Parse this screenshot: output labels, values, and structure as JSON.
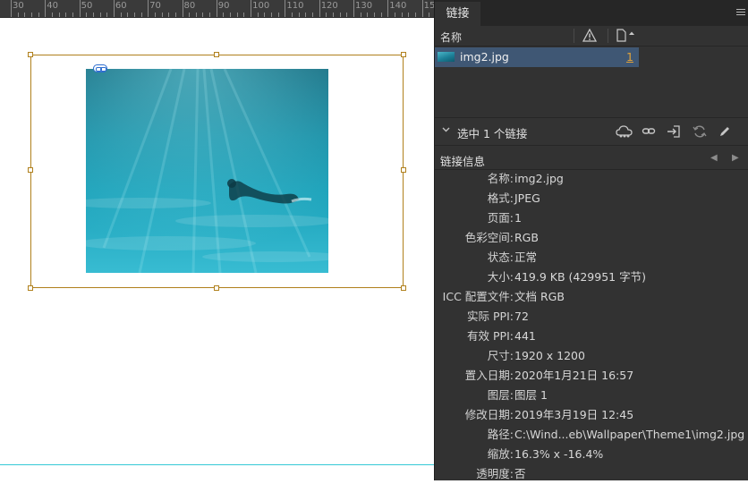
{
  "ruler": {
    "labels": [
      "30",
      "40",
      "50",
      "60",
      "70",
      "80",
      "90",
      "100",
      "110",
      "120",
      "130",
      "140",
      "150"
    ]
  },
  "panel": {
    "tab_label": "链接",
    "column_name": "名称",
    "links": [
      {
        "name": "img2.jpg",
        "page": "1"
      }
    ],
    "selection_label": "选中 1 个链接",
    "info_title": "链接信息",
    "info": [
      {
        "key": "名称:",
        "value": "img2.jpg"
      },
      {
        "key": "格式:",
        "value": "JPEG"
      },
      {
        "key": "页面:",
        "value": "1"
      },
      {
        "key": "色彩空间:",
        "value": "RGB"
      },
      {
        "key": "状态:",
        "value": "正常"
      },
      {
        "key": "大小:",
        "value": "419.9 KB   (429951 字节)"
      },
      {
        "key": "ICC 配置文件:",
        "value": "文档 RGB"
      },
      {
        "key": "实际 PPI:",
        "value": "72"
      },
      {
        "key": "有效 PPI:",
        "value": "441"
      },
      {
        "key": "尺寸:",
        "value": "1920 x 1200"
      },
      {
        "key": "置入日期:",
        "value": "2020年1月21日 16:57"
      },
      {
        "key": "图层:",
        "value": "图层 1"
      },
      {
        "key": "修改日期:",
        "value": "2019年3月19日 12:45"
      },
      {
        "key": "路径:",
        "value": "C:\\Wind...eb\\Wallpaper\\Theme1\\img2.jpg"
      },
      {
        "key": "缩放:",
        "value": "16.3% x -16.4%"
      },
      {
        "key": "透明度:",
        "value": "否"
      }
    ]
  },
  "colors": {
    "frame": "#b0801c",
    "selected_row": "#3f5774",
    "page_link": "#e0a23a",
    "guide": "#35c9d6"
  }
}
